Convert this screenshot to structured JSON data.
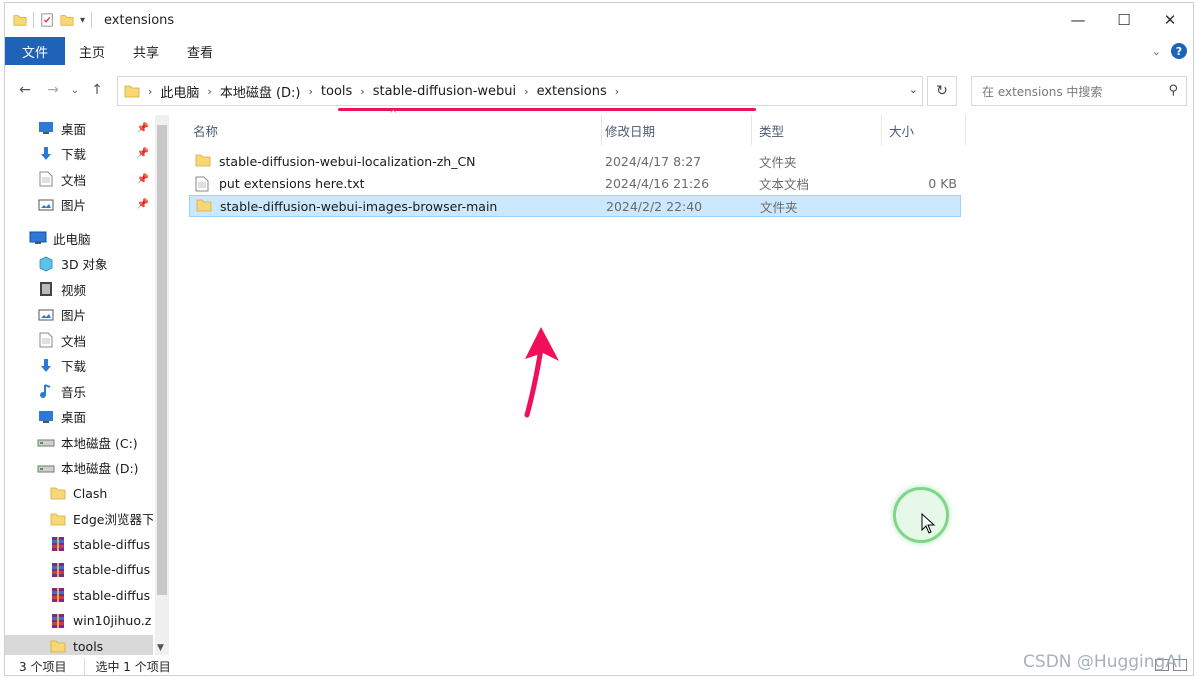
{
  "window": {
    "title": "extensions",
    "controls": {
      "minimize": "—",
      "maximize": "☐",
      "close": "✕"
    }
  },
  "ribbon": {
    "tabs": [
      "文件",
      "主页",
      "共享",
      "查看"
    ]
  },
  "address": {
    "segments": [
      "此电脑",
      "本地磁盘 (D:)",
      "tools",
      "stable-diffusion-webui",
      "extensions"
    ],
    "search_placeholder": "在 extensions 中搜索"
  },
  "nav_pane": {
    "quick_access": [
      {
        "label": "桌面",
        "icon": "desktop-icon",
        "pinned": true
      },
      {
        "label": "下载",
        "icon": "download-icon",
        "pinned": true
      },
      {
        "label": "文档",
        "icon": "document-icon",
        "pinned": true
      },
      {
        "label": "图片",
        "icon": "picture-icon",
        "pinned": true
      }
    ],
    "this_pc_label": "此电脑",
    "this_pc_items": [
      {
        "label": "3D 对象",
        "icon": "3d-objects-icon"
      },
      {
        "label": "视频",
        "icon": "video-icon"
      },
      {
        "label": "图片",
        "icon": "picture-icon"
      },
      {
        "label": "文档",
        "icon": "document-icon"
      },
      {
        "label": "下载",
        "icon": "download-icon"
      },
      {
        "label": "音乐",
        "icon": "music-icon"
      },
      {
        "label": "桌面",
        "icon": "desktop-icon"
      },
      {
        "label": "本地磁盘 (C:)",
        "icon": "drive-icon"
      },
      {
        "label": "本地磁盘 (D:)",
        "icon": "drive-icon"
      }
    ],
    "drive_d_children": [
      {
        "label": "Clash",
        "icon": "folder-icon"
      },
      {
        "label": "Edge浏览器下",
        "icon": "folder-icon"
      },
      {
        "label": "stable-diffus",
        "icon": "archive-icon"
      },
      {
        "label": "stable-diffus",
        "icon": "archive-icon"
      },
      {
        "label": "stable-diffus",
        "icon": "archive-icon"
      },
      {
        "label": "win10jihuo.z",
        "icon": "archive-icon"
      },
      {
        "label": "tools",
        "icon": "folder-icon",
        "selected": true
      }
    ]
  },
  "columns": {
    "name": "名称",
    "date": "修改日期",
    "type": "类型",
    "size": "大小"
  },
  "files": [
    {
      "name": "stable-diffusion-webui-localization-zh_CN",
      "date": "2024/4/17 8:27",
      "type": "文件夹",
      "size": "",
      "icon": "folder-icon"
    },
    {
      "name": "put extensions here.txt",
      "date": "2024/4/16 21:26",
      "type": "文本文档",
      "size": "0 KB",
      "icon": "text-file-icon"
    },
    {
      "name": "stable-diffusion-webui-images-browser-main",
      "date": "2024/2/2 22:40",
      "type": "文件夹",
      "size": "",
      "icon": "folder-icon",
      "selected": true
    }
  ],
  "status": {
    "item_count": "3 个项目",
    "selection": "选中 1 个项目"
  },
  "watermark": "CSDN @HuggingAI",
  "colors": {
    "file_tab": "#1e63b8",
    "selection_bg": "#cce8ff",
    "annotation": "#f0105a",
    "folder": "#f8d775"
  }
}
